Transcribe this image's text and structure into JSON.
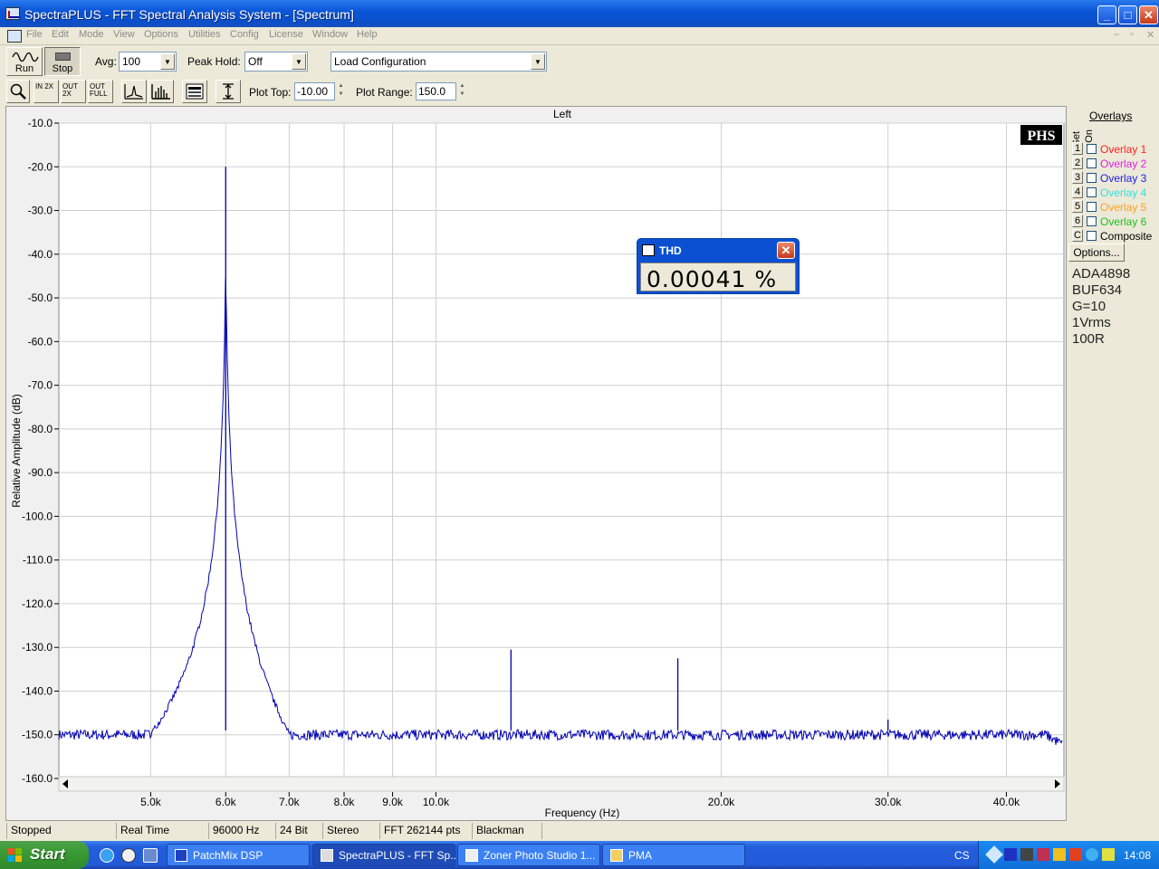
{
  "window": {
    "title": "SpectraPLUS - FFT Spectral Analysis System - [Spectrum]"
  },
  "menu": [
    "File",
    "Edit",
    "Mode",
    "View",
    "Options",
    "Utilities",
    "Config",
    "License",
    "Window",
    "Help"
  ],
  "toolbar": {
    "run_label": "Run",
    "stop_label": "Stop",
    "avg_label": "Avg:",
    "avg_value": "100",
    "peak_hold_label": "Peak Hold:",
    "peak_hold_value": "Off",
    "config_value": "Load Configuration",
    "plot_top_label": "Plot Top:",
    "plot_top_value": "-10.00",
    "plot_range_label": "Plot Range:",
    "plot_range_value": "150.0",
    "zoom_in_label": "IN 2X",
    "zoom_out_label": "OUT 2X",
    "zoom_full_label": "OUT FULL"
  },
  "chart_data": {
    "type": "line",
    "title": "Left",
    "xlabel": "Frequency (Hz)",
    "ylabel": "Relative Amplitude (dB)",
    "x_scale": "log",
    "xlim": [
      4000,
      46000
    ],
    "ylim": [
      -160,
      -10
    ],
    "y_ticks": [
      "-10.0",
      "-20.0",
      "-30.0",
      "-40.0",
      "-50.0",
      "-60.0",
      "-70.0",
      "-80.0",
      "-90.0",
      "-100.0",
      "-110.0",
      "-120.0",
      "-130.0",
      "-140.0",
      "-150.0",
      "-160.0"
    ],
    "x_ticks": [
      {
        "value": 5000,
        "label": "5.0k"
      },
      {
        "value": 6000,
        "label": "6.0k"
      },
      {
        "value": 7000,
        "label": "7.0k"
      },
      {
        "value": 8000,
        "label": "8.0k"
      },
      {
        "value": 9000,
        "label": "9.0k"
      },
      {
        "value": 10000,
        "label": "10.0k"
      },
      {
        "value": 20000,
        "label": "20.0k"
      },
      {
        "value": 30000,
        "label": "30.0k"
      },
      {
        "value": 40000,
        "label": "40.0k"
      }
    ],
    "noise_floor_db": -150,
    "peaks": [
      {
        "freq": 6000,
        "db": -20
      },
      {
        "freq": 12000,
        "db": -130.5
      },
      {
        "freq": 18000,
        "db": -132.5
      },
      {
        "freq": 30000,
        "db": -146.5
      }
    ],
    "grid": true,
    "badge": "PHS",
    "line_color": "#0000b0"
  },
  "overlays": {
    "header": "Overlays",
    "set_label": "Set",
    "on_label": "On",
    "items": [
      {
        "key": "1",
        "label": "Overlay 1",
        "color": "#ff2020"
      },
      {
        "key": "2",
        "label": "Overlay 2",
        "color": "#e020e0"
      },
      {
        "key": "3",
        "label": "Overlay 3",
        "color": "#2020e0"
      },
      {
        "key": "4",
        "label": "Overlay 4",
        "color": "#30e0e0"
      },
      {
        "key": "5",
        "label": "Overlay 5",
        "color": "#ffa020"
      },
      {
        "key": "6",
        "label": "Overlay 6",
        "color": "#20c020"
      },
      {
        "key": "C",
        "label": "Composite",
        "color": "#000000"
      }
    ],
    "options_label": "Options..."
  },
  "notes": [
    "ADA4898",
    "BUF634",
    "G=10",
    "1Vrms",
    "100R"
  ],
  "thd": {
    "title": "THD",
    "value": "0.00041 %"
  },
  "status": [
    "Stopped",
    "Real Time",
    "96000 Hz",
    "24 Bit",
    "Stereo",
    "FFT 262144 pts",
    "Blackman"
  ],
  "taskbar": {
    "start_label": "Start",
    "tasks": [
      {
        "label": "PatchMix DSP"
      },
      {
        "label": "SpectraPLUS - FFT Sp..."
      },
      {
        "label": "Zoner Photo Studio 1..."
      },
      {
        "label": "PMA"
      }
    ],
    "language": "CS",
    "clock": "14:08"
  }
}
